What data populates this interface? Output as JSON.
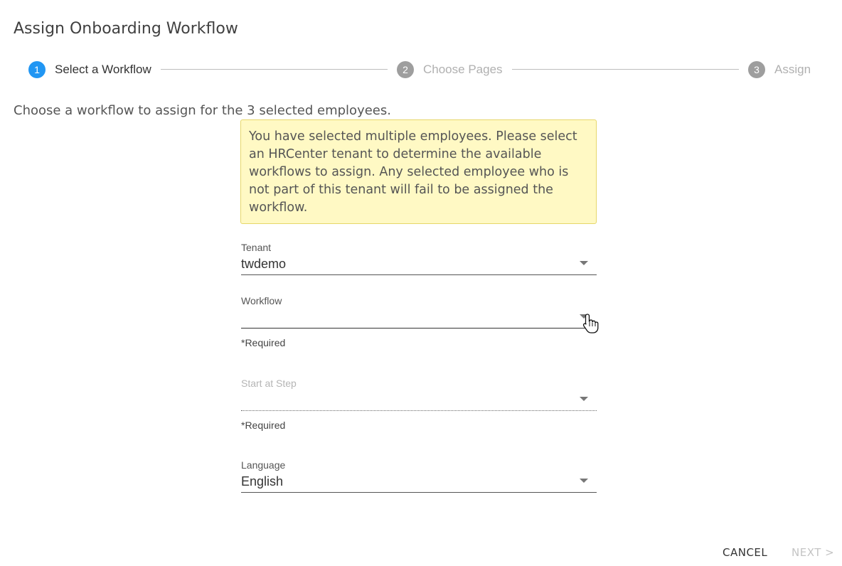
{
  "dialog": {
    "title": "Assign Onboarding Workflow"
  },
  "stepper": {
    "steps": [
      {
        "number": "1",
        "label": "Select a Workflow"
      },
      {
        "number": "2",
        "label": "Choose Pages"
      },
      {
        "number": "3",
        "label": "Assign"
      }
    ]
  },
  "instructions": "Choose a workflow to assign for the 3 selected employees.",
  "warning": "You have selected multiple employees. Please select an HRCenter tenant to determine the available workflows to assign. Any selected employee who is not part of this tenant will fail to be assigned the workflow.",
  "form": {
    "tenant": {
      "label": "Tenant",
      "value": "twdemo"
    },
    "workflow": {
      "label": "Workflow",
      "value": "",
      "helper": "*Required"
    },
    "start_step": {
      "label": "Start at Step",
      "value": "",
      "helper": "*Required"
    },
    "language": {
      "label": "Language",
      "value": "English"
    }
  },
  "actions": {
    "cancel": "CANCEL",
    "next": "NEXT >"
  },
  "colors": {
    "accent": "#2196f3",
    "warning_bg": "#fff9c4",
    "inactive_step": "#9e9e9e"
  }
}
